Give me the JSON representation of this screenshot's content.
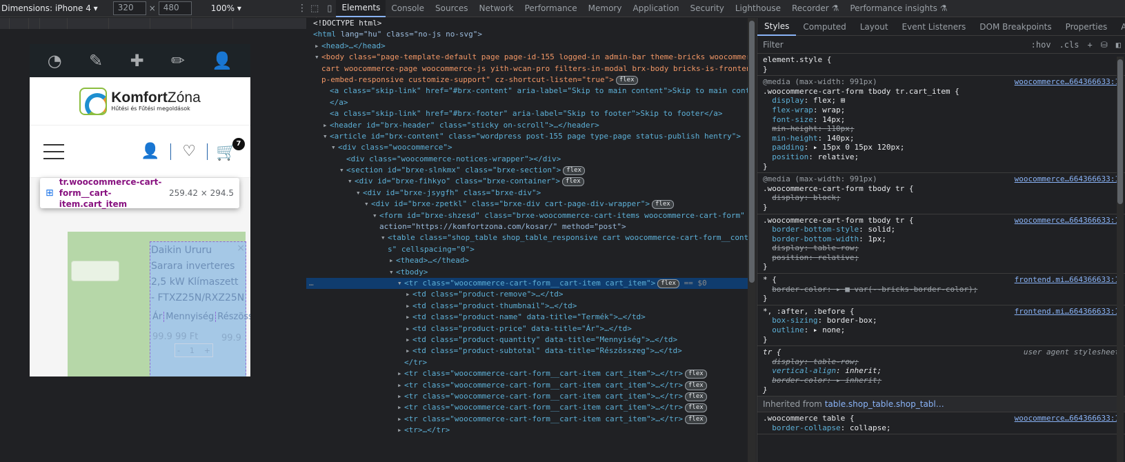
{
  "device_toolbar": {
    "dimensions_label": "Dimensions: iPhone 4",
    "width_value": "320",
    "height_value": "480",
    "times": "×",
    "zoom": "100%"
  },
  "viewport": {
    "logo_name_bold": "Komfort",
    "logo_name_light": "Zóna",
    "logo_sub": "Hűtési és Fűtési megoldások",
    "cart_count": "7",
    "product_name": "Daikin Ururu Sarara inverteres 2,5 kW Klímaszett - FTXZ25N/RXZ25N",
    "col_price": "Ár",
    "col_qty": "Mennyiség",
    "col_subtotal": "Részösszeg",
    "price_value": "99.9 99 Ft",
    "qty_minus": "-",
    "qty_value": "1",
    "qty_plus": "+",
    "subtotal_value": "99.9",
    "close_symbol": "×"
  },
  "tooltip": {
    "name": "tr.woocommerce-cart-form__cart-item.cart_item",
    "size": "259.42 × 294.5"
  },
  "top_tabs": [
    "Elements",
    "Console",
    "Sources",
    "Network",
    "Performance",
    "Memory",
    "Application",
    "Security",
    "Lighthouse",
    "Recorder",
    "Performance insights"
  ],
  "dom": {
    "doctype": "<!DOCTYPE html>",
    "html_tag": "<html",
    "html_attrs": " lang=\"hu\" class=\"no-js no-svg\">",
    "head": "<head>…</head>",
    "body1": "<body class=\"page-template-default page page-id-155 logged-in admin-bar theme-bricks woocommerce-",
    "body2": "cart woocommerce-page woocommerce-js yith-wcan-pro filters-in-modal brx-body bricks-is-frontend w",
    "body3": "p-embed-responsive customize-support\" cz-shortcut-listen=\"true\">",
    "skip1a": "<a class=\"skip-link\" href=\"#brx-content\" aria-label=\"Skip to main content\">Skip to main content",
    "skip1b": "</a>",
    "skip2": "<a class=\"skip-link\" href=\"#brx-footer\" aria-label=\"Skip to footer\">Skip to footer</a>",
    "header": "<header id=\"brx-header\" class=\"sticky on-scroll\">…</header>",
    "article": "<article id=\"brx-content\" class=\"wordpress post-155 page type-page status-publish hentry\">",
    "div_wc": "<div class=\"woocommerce\">",
    "div_notices": "<div class=\"woocommerce-notices-wrapper\"></div>",
    "section": "<section id=\"brxe-slnkmx\" class=\"brxe-section\">",
    "container": "<div id=\"brxe-fihkyo\" class=\"brxe-container\">",
    "div_jsy": "<div id=\"brxe-jsygfh\" class=\"brxe-div\">",
    "div_zpe": "<div id=\"brxe-zpetkl\" class=\"brxe-div cart-page-div-wrapper\">",
    "form1": "<form id=\"brxe-shzesd\" class=\"brxe-woocommerce-cart-items woocommerce-cart-form\"",
    "form2": "action=\"https://komfortzona.com/kosar/\" method=\"post\">",
    "table1": "<table class=\"shop_table shop_table_responsive cart woocommerce-cart-form__content",
    "table2": "s\" cellspacing=\"0\">",
    "thead": "<thead>…</thead>",
    "tbody": "<tbody>",
    "tr_sel": "<tr class=\"woocommerce-cart-form__cart-item cart_item\">",
    "eq": "== $0",
    "td1": "<td class=\"product-remove\">…</td>",
    "td2": "<td class=\"product-thumbnail\">…</td>",
    "td3": "<td class=\"product-name\" data-title=\"Termék\">…</td>",
    "td4": "<td class=\"product-price\" data-title=\"Ár\">…</td>",
    "td5": "<td class=\"product-quantity\" data-title=\"Mennyiség\">…</td>",
    "td6": "<td class=\"product-subtotal\" data-title=\"Részösszeg\">…</td>",
    "tr_close": "</tr>",
    "tr_row": "<tr class=\"woocommerce-cart-form__cart-item cart_item\">…</tr>",
    "tr_last": "<tr>…</tr>",
    "flex": "flex"
  },
  "styles": {
    "tabs": [
      "Styles",
      "Computed",
      "Layout",
      "Event Listeners",
      "DOM Breakpoints",
      "Properties",
      "Ac"
    ],
    "filter_placeholder": "Filter",
    "hov": ":hov",
    "cls": ".cls",
    "element_style": "element.style {",
    "rules": {
      "r1_mq": "@media (max-width: 991px)",
      "r1_sel": ".woocommerce-cart-form tbody tr.cart_item {",
      "r1_src": "woocommerce…664366633:1",
      "r2_mq": "@media (max-width: 991px)",
      "r2_sel": ".woocommerce-cart-form tbody tr {",
      "r2_src": "woocommerce…664366633:1",
      "r3_sel": ".woocommerce-cart-form tbody tr {",
      "r3_src": "woocommerce…664366633:1",
      "r4_sel": "* {",
      "r4_src": "frontend.mi…664366633:1",
      "r5_sel": "*, :after, :before {",
      "r5_src": "frontend.mi…664366633:1",
      "r6_sel": "tr {",
      "r6_src": "user agent stylesheet",
      "inherited_label": "Inherited from",
      "inherited_from": "table.shop_table.shop_tabl…",
      "r7_sel": ".woocommerce table {",
      "r7_src": "woocommerce…664366633:1"
    }
  }
}
